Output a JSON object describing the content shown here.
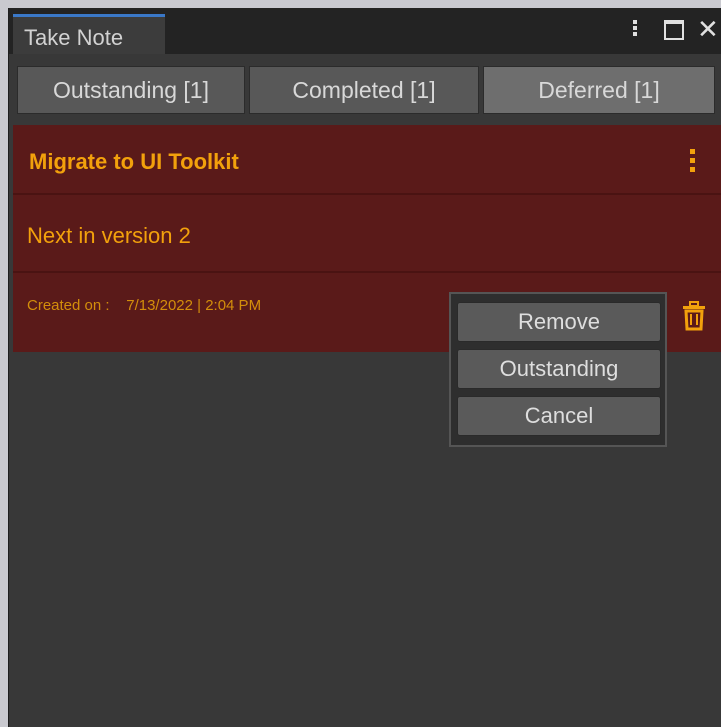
{
  "window": {
    "tab_title": "Take Note"
  },
  "tabs": [
    {
      "label": "Outstanding [1]"
    },
    {
      "label": "Completed [1]"
    },
    {
      "label": "Deferred [1]"
    }
  ],
  "note": {
    "title": "Migrate to UI Toolkit",
    "description": "Next in version 2",
    "created_label": "Created on :",
    "created_value": "7/13/2022 | 2:04 PM"
  },
  "context_menu": {
    "items": [
      {
        "label": "Remove"
      },
      {
        "label": "Outstanding"
      },
      {
        "label": "Cancel"
      }
    ]
  },
  "colors": {
    "note_background": "#5a1a19",
    "note_text": "#f2a10c",
    "panel_background": "#383838"
  }
}
